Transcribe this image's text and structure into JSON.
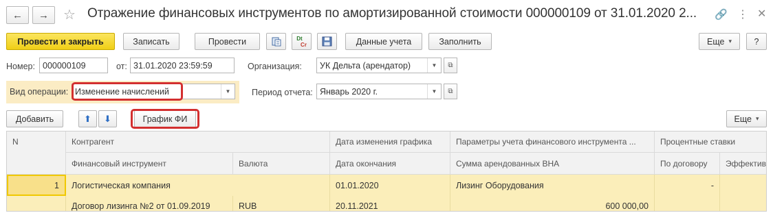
{
  "header": {
    "back_icon": "arrow-left-icon",
    "forward_icon": "arrow-right-icon",
    "title": "Отражение финансовых инструментов по амортизированной стоимости 000000109 от 31.01.2020 2...",
    "link_icon": "link-icon",
    "more_icon": "vertical-dots-icon",
    "close_icon": "close-icon"
  },
  "toolbar": {
    "post_close": "Провести и закрыть",
    "write": "Записать",
    "post": "Провести",
    "accounting_data": "Данные учета",
    "fill": "Заполнить",
    "more": "Еще",
    "help": "?",
    "dtkt_top": "Dt",
    "dtkt_bottom": "Cr"
  },
  "form": {
    "number_label": "Номер:",
    "number_value": "000000109",
    "date_label": "от:",
    "date_value": "31.01.2020 23:59:59",
    "org_label": "Организация:",
    "org_value": "УК Дельта (арендатор)",
    "optype_label": "Вид операции:",
    "optype_value": "Изменение начислений",
    "period_label": "Период отчета:",
    "period_value": "Январь 2020 г."
  },
  "table_toolbar": {
    "add": "Добавить",
    "schedule": "График ФИ",
    "more": "Еще"
  },
  "table": {
    "headers_row1": [
      "N",
      "Контрагент",
      "Дата изменения графика",
      "Параметры учета финансового инструмента ...",
      "Процентные ставки"
    ],
    "headers_row2": [
      "Финансовый инструмент",
      "Валюта",
      "Дата окончания",
      "Сумма арендованных ВНА",
      "По договору",
      "Эффективн"
    ],
    "rows": [
      {
        "n": "1",
        "counterparty": "Логистическая компания",
        "change_date": "01.01.2020",
        "params": "Лизинг Оборудования",
        "rate_contract": "-",
        "rate_effective": "",
        "instrument": "Договор лизинга №2 от 01.09.2019",
        "currency": "RUB",
        "end_date": "20.11.2021",
        "amount": "600 000,00"
      }
    ]
  }
}
